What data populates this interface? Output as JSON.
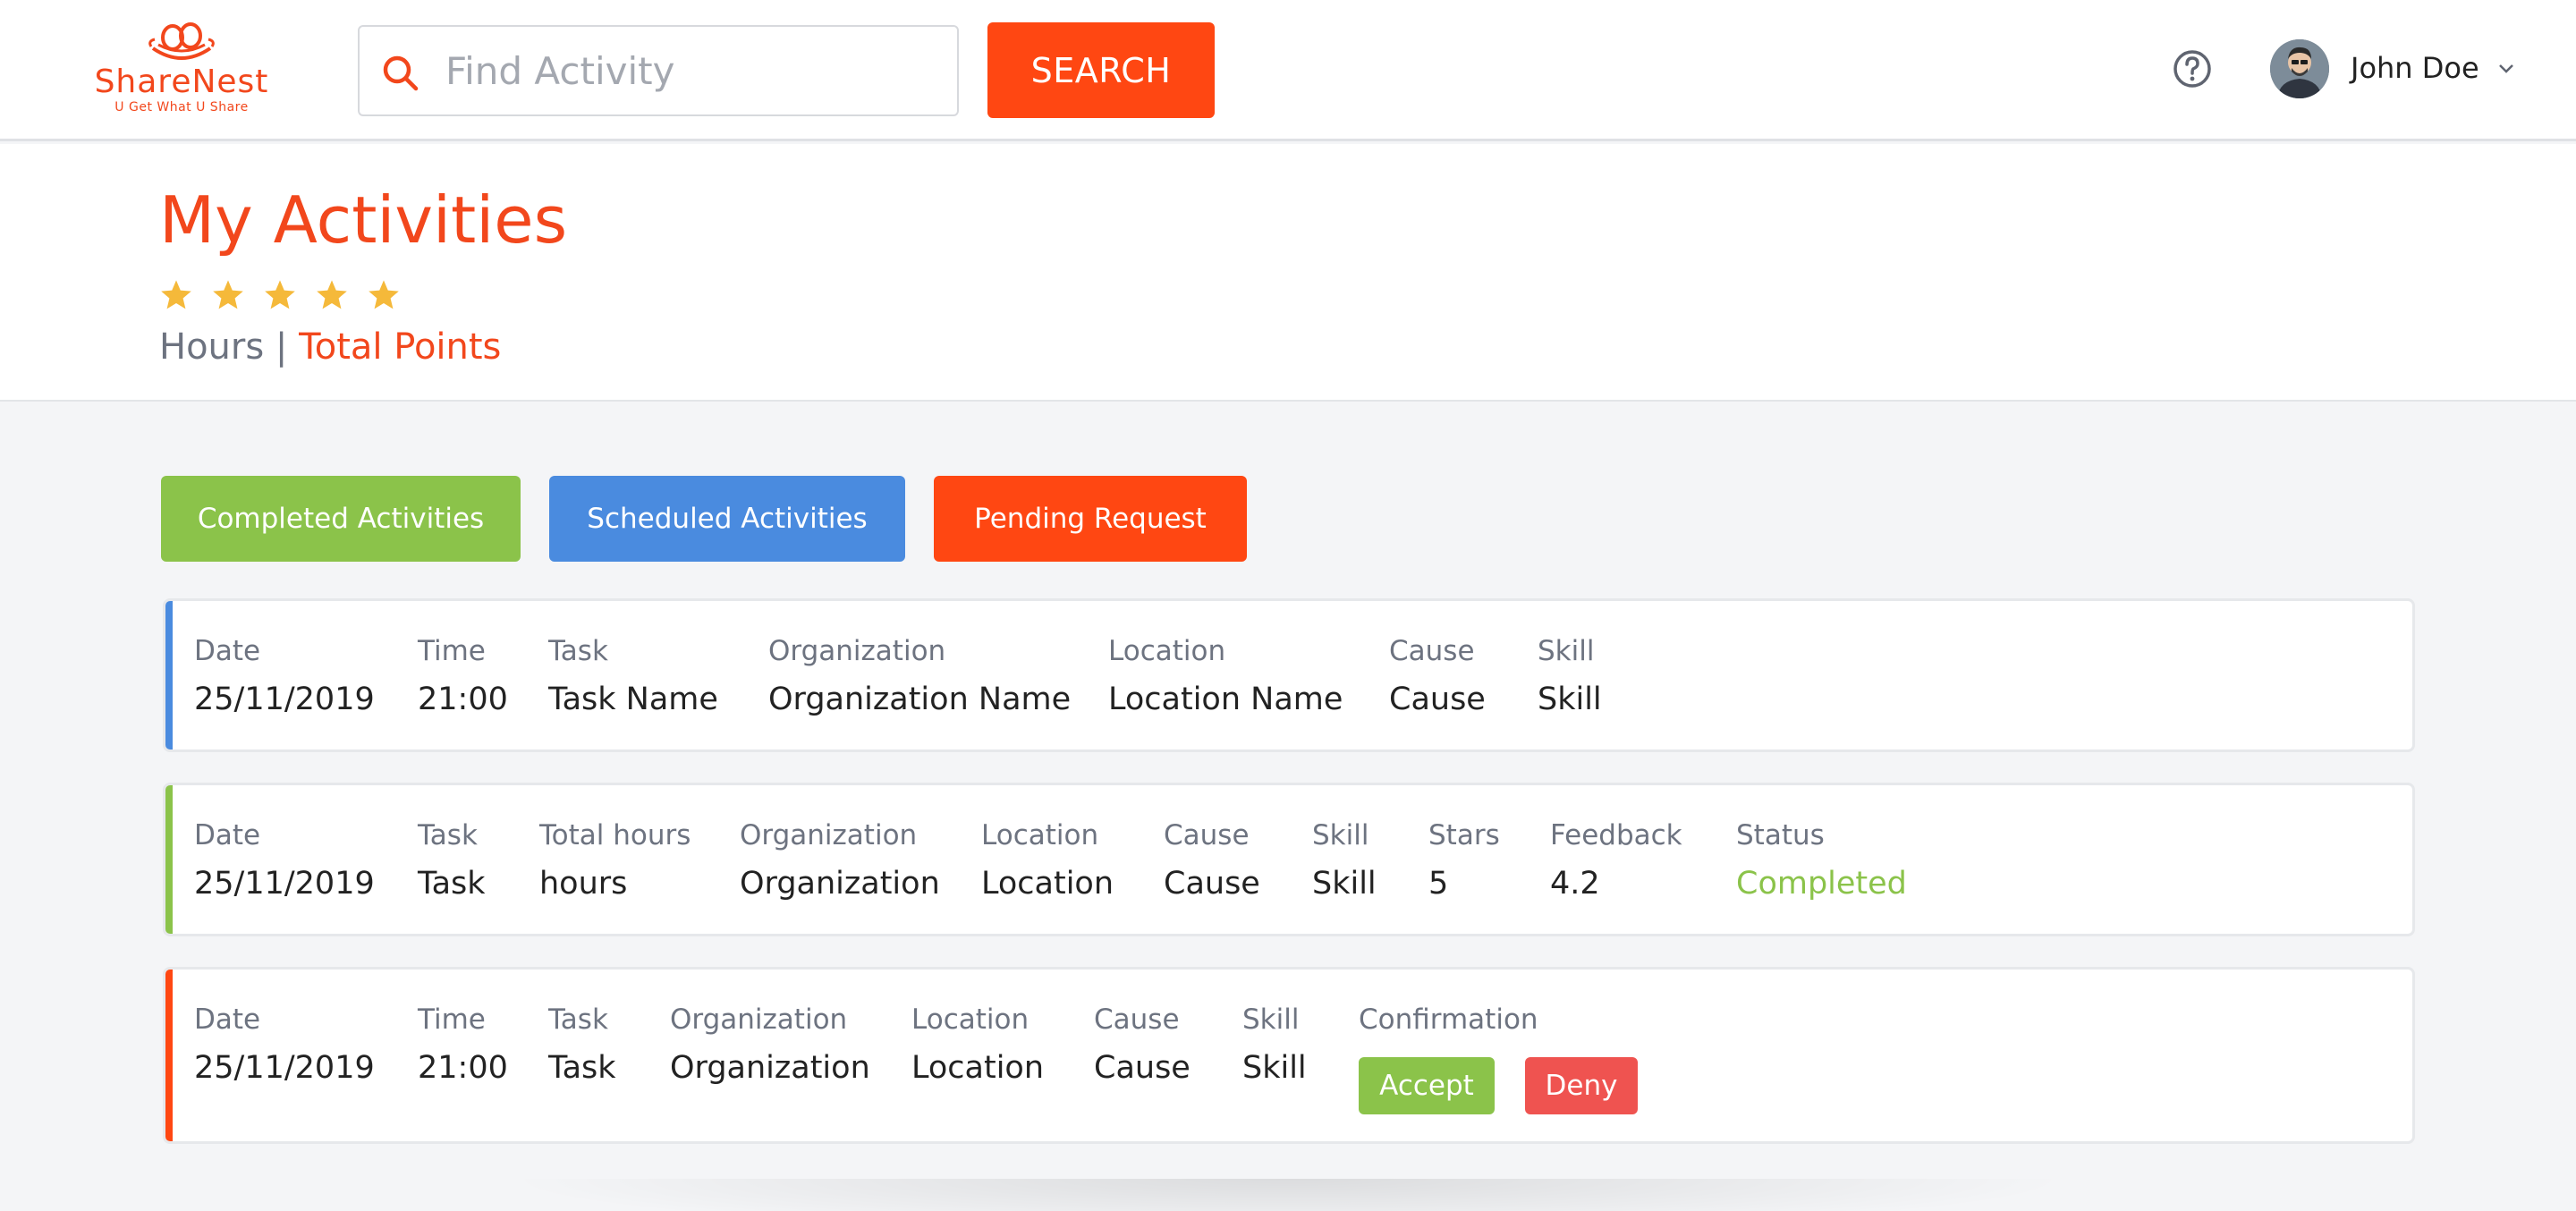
{
  "header": {
    "logo_name": "ShareNest",
    "logo_tagline": "U Get What U Share",
    "search_placeholder": "Find Activity",
    "search_value": "",
    "search_button": "SEARCH",
    "user_name": "John Doe",
    "icons": {
      "search": "search-icon",
      "help": "help-circle-icon",
      "avatar": "user-avatar",
      "caret": "chevron-down-icon"
    }
  },
  "summary": {
    "title": "My Activities",
    "rating_stars": 5,
    "hours_label": "Hours",
    "separator": "|",
    "points_label": "Total Points"
  },
  "tabs": [
    {
      "label": "Completed Activities",
      "color": "#8bc34a"
    },
    {
      "label": "Scheduled Activities",
      "color": "#4a8bdf"
    },
    {
      "label": "Pending Request",
      "color": "#ff4712"
    }
  ],
  "cards": {
    "scheduled": {
      "accent": "#4a8bdf",
      "fields": [
        {
          "label": "Date",
          "value": "25/11/2019"
        },
        {
          "label": "Time",
          "value": "21:00"
        },
        {
          "label": "Task",
          "value": "Task Name"
        },
        {
          "label": "Organization",
          "value": "Organization Name"
        },
        {
          "label": "Location",
          "value": "Location Name"
        },
        {
          "label": "Cause",
          "value": "Cause"
        },
        {
          "label": "Skill",
          "value": "Skill"
        }
      ]
    },
    "completed": {
      "accent": "#8bc34a",
      "fields": [
        {
          "label": "Date",
          "value": "25/11/2019"
        },
        {
          "label": "Task",
          "value": "Task"
        },
        {
          "label": "Total hours",
          "value": "hours"
        },
        {
          "label": "Organization",
          "value": "Organization"
        },
        {
          "label": "Location",
          "value": "Location"
        },
        {
          "label": "Cause",
          "value": "Cause"
        },
        {
          "label": "Skill",
          "value": "Skill"
        },
        {
          "label": "Stars",
          "value": "5"
        },
        {
          "label": "Feedback",
          "value": "4.2"
        },
        {
          "label": "Status",
          "value": "Completed"
        }
      ]
    },
    "pending": {
      "accent": "#ff4712",
      "fields": [
        {
          "label": "Date",
          "value": "25/11/2019"
        },
        {
          "label": "Time",
          "value": "21:00"
        },
        {
          "label": "Task",
          "value": "Task"
        },
        {
          "label": "Organization",
          "value": "Organization"
        },
        {
          "label": "Location",
          "value": "Location"
        },
        {
          "label": "Cause",
          "value": "Cause"
        },
        {
          "label": "Skill",
          "value": "Skill"
        }
      ],
      "confirmation_label": "Confirmation",
      "accept_label": "Accept",
      "deny_label": "Deny"
    }
  },
  "colors": {
    "brand": "#f2471c",
    "search_button": "#ff4712",
    "star": "#f5b93a",
    "accept": "#8bc34a",
    "deny": "#ef5350",
    "status_completed": "#8bc34a"
  }
}
